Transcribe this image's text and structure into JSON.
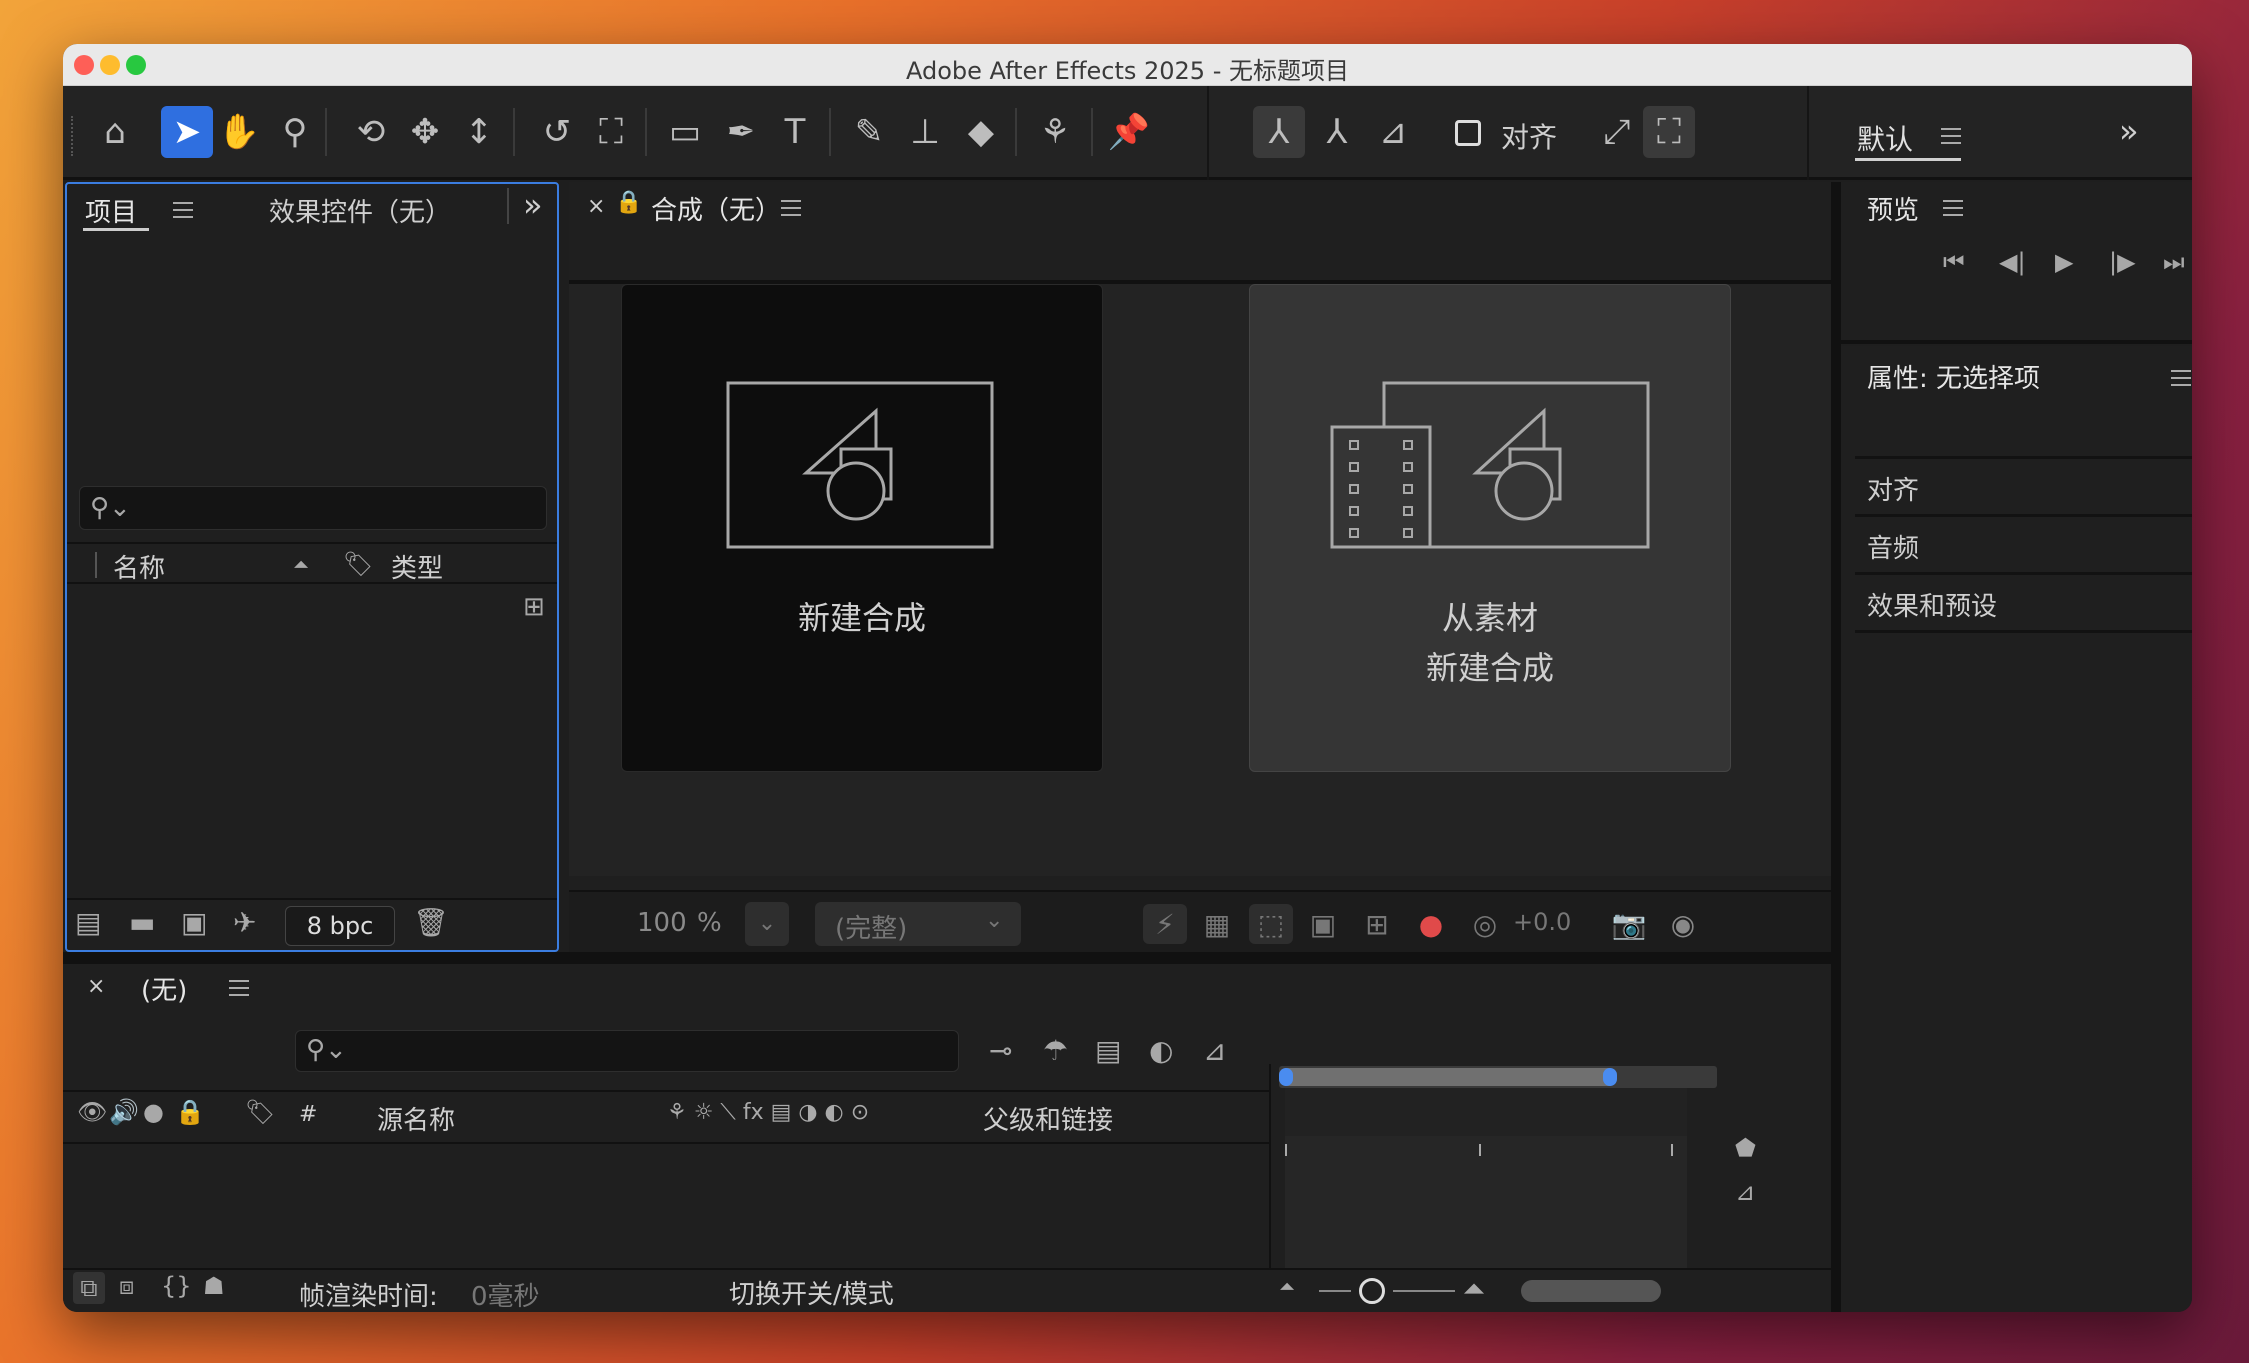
{
  "window": {
    "title": "Adobe After Effects 2025 - 无标题项目"
  },
  "toolbar": {
    "align_label": "对齐",
    "workspace_label": "默认",
    "tools": [
      "home-icon",
      "selection-tool-icon",
      "hand-tool-icon",
      "zoom-tool-icon",
      "orbit-camera-icon",
      "pan-camera-icon",
      "dolly-camera-icon",
      "rotate-tool-icon",
      "anchor-point-tool-icon",
      "rectangle-tool-icon",
      "pen-tool-icon",
      "type-tool-icon",
      "brush-tool-icon",
      "clone-stamp-icon",
      "eraser-tool-icon",
      "roto-brush-icon",
      "puppet-pin-icon"
    ]
  },
  "project_panel": {
    "tab_project": "项目",
    "tab_effects": "效果控件（无）",
    "search_placeholder": "",
    "col_name": "名称",
    "col_type": "类型",
    "bpc": "8 bpc"
  },
  "comp_panel": {
    "tab_label": "合成（无）",
    "card_new": "新建合成",
    "card_footage_line1": "从素材",
    "card_footage_line2": "新建合成",
    "zoom": "100",
    "zoom_unit": "%",
    "resolution": "(完整)",
    "exposure": "+0.0"
  },
  "right_panels": {
    "preview_title": "预览",
    "properties_title": "属性: 无选择项",
    "align": "对齐",
    "audio": "音频",
    "effects_presets": "效果和预设"
  },
  "timeline": {
    "tab_label": "(无)",
    "col_hash": "#",
    "col_source": "源名称",
    "col_parent": "父级和链接",
    "render_time_label": "帧渲染时间:",
    "render_time_value": "0毫秒",
    "toggle_label": "切换开关/模式"
  }
}
